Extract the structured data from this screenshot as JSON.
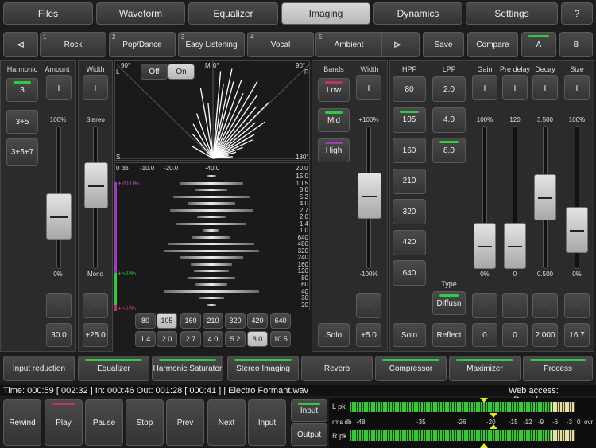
{
  "tabs": [
    "Files",
    "Waveform",
    "Equalizer",
    "Imaging",
    "Dynamics",
    "Settings",
    "?"
  ],
  "presets": {
    "prev": "⊲",
    "next": "⊳",
    "items": [
      {
        "n": "1",
        "label": "Rock"
      },
      {
        "n": "2",
        "label": "Pop/Dance"
      },
      {
        "n": "3",
        "label": "Easy Listening"
      },
      {
        "n": "4",
        "label": "Vocal"
      },
      {
        "n": "5",
        "label": "Ambient"
      }
    ],
    "save": "Save",
    "compare": "Compare",
    "a": "A",
    "b": "B"
  },
  "harmonic": {
    "title": "Harmonic",
    "buttons": [
      "3",
      "3+5",
      "3+5+7"
    ],
    "amount_title": "Amount",
    "amount_top": "100%",
    "amount_bottom": "0%",
    "amount_value": "30.0",
    "plus": "+",
    "minus": "−",
    "amount_level": 0.3
  },
  "width": {
    "title": "Width",
    "top": "Stereo",
    "bottom": "Mono",
    "value": "+25.0",
    "level": 0.62
  },
  "scope": {
    "off": "Off",
    "on": "On",
    "left": "L",
    "mid": "M",
    "right": "R",
    "deg90l": "90°",
    "deg0": "0°",
    "deg90r": "90°",
    "s": "S",
    "deg180": "180°"
  },
  "eqdisplay": {
    "db_labels": [
      "0 db",
      "-10.0",
      "-20.0",
      "-40.0",
      "20.0"
    ],
    "freqs": [
      "15.0",
      "10.5",
      "8.0",
      "5.2",
      "4.0",
      "2.7",
      "2.0",
      "1.4",
      "1.0",
      "640",
      "480",
      "320",
      "240",
      "160",
      "120",
      "80",
      "60",
      "40",
      "30",
      "20"
    ],
    "marks": [
      "+20.0%",
      "+5.0%",
      "+5.0%"
    ],
    "freq_buttons": [
      "80",
      "105",
      "160",
      "210",
      "320",
      "420",
      "640"
    ],
    "khz_buttons": [
      "1.4",
      "2.0",
      "2.7",
      "4.0",
      "5.2",
      "8.0",
      "10.5"
    ],
    "selected_freq": "105",
    "selected_khz": "8.0"
  },
  "bands": {
    "title": "Bands",
    "buttons": [
      "Low",
      "Mid",
      "High"
    ],
    "solo": "Solo",
    "width_title": "Width",
    "width_top": "+100%",
    "width_bottom": "-100%",
    "width_value": "+5.0",
    "width_level": 0.52
  },
  "reverb": {
    "hpf_title": "HPF",
    "hpf": [
      "80",
      "105",
      "160",
      "210",
      "320",
      "420",
      "640"
    ],
    "lpf_title": "LPF",
    "lpf": [
      "2.0",
      "4.0",
      "8.0"
    ],
    "type_title": "Type",
    "types": [
      "Diffusn",
      "Reflect"
    ],
    "solo": "Solo",
    "gain_title": "Gain",
    "gain_top": "100%",
    "gain_bottom": "0%",
    "gain_value": "0",
    "gain_level": 0.0,
    "predelay_title": "Pre delay",
    "predelay_top": "120",
    "predelay_bottom": "0",
    "predelay_value": "0",
    "predelay_level": 0.0,
    "decay_title": "Decay",
    "decay_top": "3.500",
    "decay_bottom": "0.500",
    "decay_value": "2.000",
    "decay_level": 0.5,
    "size_title": "Size",
    "size_top": "100%",
    "size_bottom": "0%",
    "size_value": "16.7",
    "size_level": 0.167
  },
  "chain": [
    "Input reduction",
    "Equalizer",
    "Harmonic Saturator",
    "Stereo Imaging",
    "Reverb",
    "Compressor",
    "Maximizer",
    "Process"
  ],
  "status": {
    "time": "Time: 000:59 [ 002:32 ] In: 000:46 Out: 001:28 [ 000:41 ] | Electro Formant.wav",
    "web": "Web access: <Disable>"
  },
  "transport": [
    "Rewind",
    "Play",
    "Pause",
    "Stop",
    "Prev",
    "Next",
    "Input"
  ],
  "io": [
    "Input",
    "Output"
  ],
  "meter": {
    "lpk": "L pk",
    "rpk": "R pk",
    "rms": "rms db",
    "scale": [
      "-48",
      "-35",
      "-26",
      "-20",
      "-15",
      "-12",
      "-9",
      "-6",
      "-3",
      "0",
      "ovr"
    ],
    "l_level": 0.82,
    "r_level": 0.82
  }
}
